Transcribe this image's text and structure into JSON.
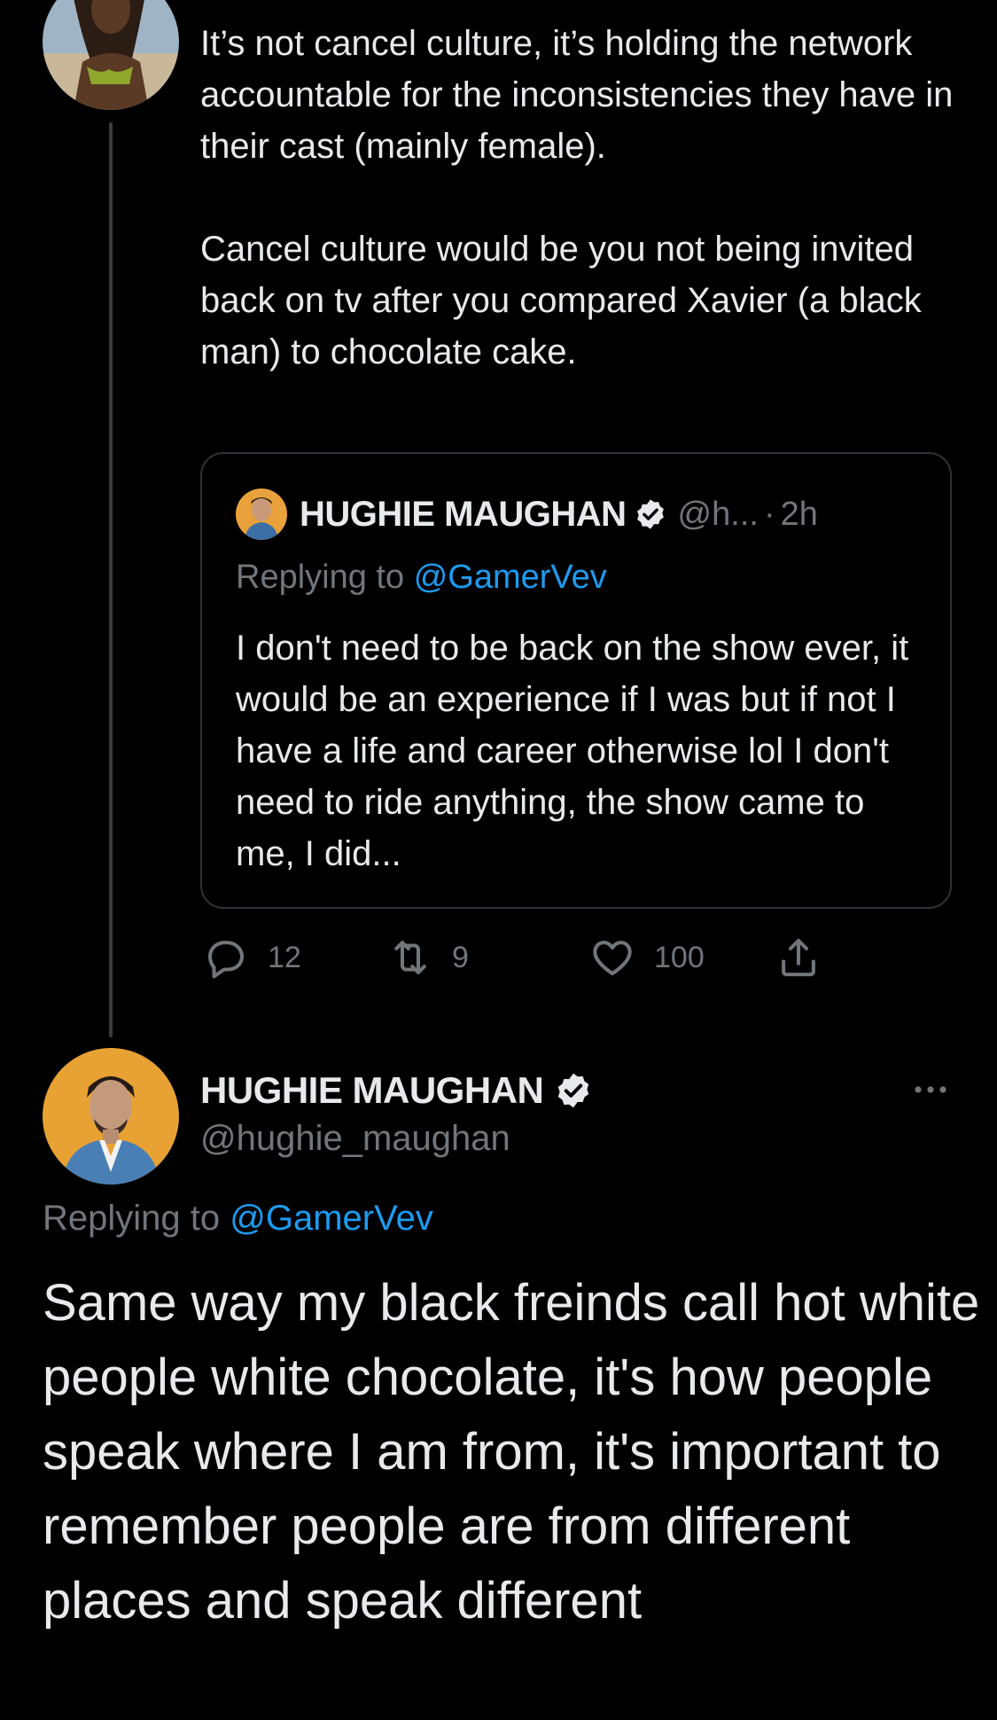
{
  "parent_tweet": {
    "text": "It’s not cancel culture, it’s holding the network accountable for the inconsistencies they have in their cast (mainly female).\n\nCancel culture would be you not being invited back on tv after you compared Xavier (a black man) to chocolate cake.",
    "quoted_tweet": {
      "name": "HUGHIE MAUGHAN",
      "handle": "@h...",
      "dot": "·",
      "time": "2h",
      "replying_prefix": "Replying to",
      "replying_to": "@GamerVev",
      "text": "I don't need to be back on the show ever, it would be an experience if I was but if not I have a life and career otherwise lol I don't need to ride anything, the show came to me, I did..."
    },
    "actions": {
      "replies": "12",
      "retweets": "9",
      "likes": "100"
    }
  },
  "main_tweet": {
    "name": "HUGHIE MAUGHAN",
    "handle": "@hughie_maughan",
    "replying_prefix": "Replying to",
    "replying_to": "@GamerVev",
    "text": "Same way my black freinds call hot white people white chocolate, it's how people speak where I am from, it's important to remember people are from different places and speak different"
  },
  "colors": {
    "background": "#000000",
    "text": "#e7e9ea",
    "secondary": "#71767b",
    "accent": "#1d9bf0",
    "border": "#2f3336"
  },
  "icons": [
    "avatar",
    "verified-badge-icon",
    "reply-icon",
    "retweet-icon",
    "like-icon",
    "share-icon",
    "more-options-icon"
  ]
}
